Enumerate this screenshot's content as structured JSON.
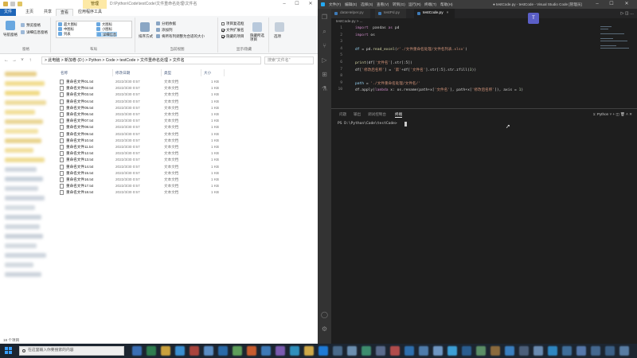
{
  "explorer": {
    "title": {
      "manage_tab": "管理",
      "path": "D:\\Python\\Code\\testCode\\文件重命名处理\\文件名"
    },
    "ribbon_tabs": [
      "文件",
      "主页",
      "共享",
      "查看",
      "应用程序工具"
    ],
    "ribbon": {
      "panes_group": {
        "label": "窗格",
        "nav_pane": "导航窗格",
        "preview_pane": "预览窗格",
        "details_pane": "详细信息窗格"
      },
      "layout_group": {
        "label": "布局",
        "items": [
          "超大图标",
          "大图标",
          "中图标",
          "小图标",
          "列表",
          "详细信息",
          "平铺",
          "内容"
        ],
        "selected": "详细信息"
      },
      "current_view_group": {
        "label": "当前视图",
        "sort_by": "排序方式",
        "group_by": "分组依据",
        "add_columns": "添加列",
        "fit_columns": "将所有列调整为合适的大小"
      },
      "show_hide_group": {
        "label": "显示/隐藏",
        "item_checkboxes": "项目复选框",
        "file_extensions": "文件扩展名",
        "hidden_items": "隐藏的项目",
        "hide_selected": "隐藏所选项目"
      },
      "options_label": "选项"
    },
    "address": "> 此电脑 > 新加卷 (D:) > Python > Code > testCode > 文件重命名处理 > 文件名",
    "search_placeholder": "搜索\"文件名\"",
    "columns": [
      "名称",
      "修改日期",
      "类型",
      "大小"
    ],
    "files": [
      {
        "name": "重命名文件01.txt",
        "date": "2022/3/30 0:57",
        "type": "文本文档",
        "size": "1 KB"
      },
      {
        "name": "重命名文件02.txt",
        "date": "2022/3/30 0:57",
        "type": "文本文档",
        "size": "1 KB"
      },
      {
        "name": "重命名文件03.txt",
        "date": "2022/3/30 0:57",
        "type": "文本文档",
        "size": "1 KB"
      },
      {
        "name": "重命名文件04.txt",
        "date": "2022/3/30 0:57",
        "type": "文本文档",
        "size": "1 KB"
      },
      {
        "name": "重命名文件05.txt",
        "date": "2022/3/30 0:57",
        "type": "文本文档",
        "size": "1 KB"
      },
      {
        "name": "重命名文件06.txt",
        "date": "2022/3/30 0:57",
        "type": "文本文档",
        "size": "1 KB"
      },
      {
        "name": "重命名文件07.txt",
        "date": "2022/3/30 0:57",
        "type": "文本文档",
        "size": "1 KB"
      },
      {
        "name": "重命名文件08.txt",
        "date": "2022/3/30 0:57",
        "type": "文本文档",
        "size": "1 KB"
      },
      {
        "name": "重命名文件09.txt",
        "date": "2022/3/30 0:57",
        "type": "文本文档",
        "size": "1 KB"
      },
      {
        "name": "重命名文件10.txt",
        "date": "2022/3/30 0:57",
        "type": "文本文档",
        "size": "1 KB"
      },
      {
        "name": "重命名文件11.txt",
        "date": "2022/3/30 0:57",
        "type": "文本文档",
        "size": "1 KB"
      },
      {
        "name": "重命名文件12.txt",
        "date": "2022/3/30 0:57",
        "type": "文本文档",
        "size": "1 KB"
      },
      {
        "name": "重命名文件13.txt",
        "date": "2022/3/30 0:57",
        "type": "文本文档",
        "size": "1 KB"
      },
      {
        "name": "重命名文件14.txt",
        "date": "2022/3/30 0:57",
        "type": "文本文档",
        "size": "1 KB"
      },
      {
        "name": "重命名文件15.txt",
        "date": "2022/3/30 0:57",
        "type": "文本文档",
        "size": "1 KB"
      },
      {
        "name": "重命名文件16.txt",
        "date": "2022/3/30 0:57",
        "type": "文本文档",
        "size": "1 KB"
      },
      {
        "name": "重命名文件17.txt",
        "date": "2022/3/30 0:57",
        "type": "文本文档",
        "size": "1 KB"
      },
      {
        "name": "重命名文件18.txt",
        "date": "2022/3/30 0:57",
        "type": "文本文档",
        "size": "1 KB"
      }
    ],
    "status": "18 个项目"
  },
  "vscode": {
    "menu": [
      "文件(F)",
      "编辑(E)",
      "选择(S)",
      "查看(V)",
      "转到(G)",
      "运行(R)",
      "终端(T)",
      "帮助(H)"
    ],
    "window_title": "● testCode.py - testCode - Visual Studio Code [管理员]",
    "tabs": [
      {
        "label": "dataHelper.py",
        "active": false
      },
      {
        "label": "testPd.py",
        "active": false
      },
      {
        "label": "testCode.py",
        "active": true
      }
    ],
    "breadcrumb": "testCode.py > ...",
    "code_lines": [
      {
        "no": "1",
        "html_parts": [
          [
            "kw",
            "import"
          ],
          [
            "",
            "  pandas "
          ],
          [
            "kw",
            "as"
          ],
          [
            "",
            " pd"
          ]
        ]
      },
      {
        "no": "2",
        "html_parts": [
          [
            "kw",
            "import"
          ],
          [
            "",
            "",
            " os"
          ]
        ]
      },
      {
        "no": "3",
        "html_parts": []
      },
      {
        "no": "4",
        "html_parts": [
          [
            "var",
            "df"
          ],
          [
            "",
            " = pd."
          ],
          [
            "fn",
            "read_excel"
          ],
          [
            "",
            "("
          ],
          [
            "str",
            "r'./文件重命名处理/文件名列表.xlsx'"
          ],
          [
            "",
            ")"
          ]
        ]
      },
      {
        "no": "5",
        "html_parts": []
      },
      {
        "no": "6",
        "html_parts": [
          [
            "fn",
            "print"
          ],
          [
            "",
            "(df["
          ],
          [
            "str",
            "'文件名'"
          ],
          [
            "",
            "].str[:5])"
          ]
        ]
      },
      {
        "no": "7",
        "html_parts": [
          [
            "",
            "df["
          ],
          [
            "str",
            "'修改后名称'"
          ],
          [
            "",
            "] = "
          ],
          [
            "str",
            "'第'"
          ],
          [
            "",
            "+df["
          ],
          [
            "str",
            "'文件名'"
          ],
          [
            "",
            "].str[:5].str.zfill("
          ],
          [
            "num",
            "3"
          ],
          [
            "",
            "))"
          ]
        ]
      },
      {
        "no": "8",
        "html_parts": []
      },
      {
        "no": "9",
        "html_parts": [
          [
            "var",
            "path"
          ],
          [
            "",
            " = "
          ],
          [
            "str",
            "'./文件重命名处理/文件名/'"
          ]
        ]
      },
      {
        "no": "10",
        "html_parts": [
          [
            "",
            "df.apply("
          ],
          [
            "kw",
            "lambda"
          ],
          [
            "",
            " x: os.rename(path+x["
          ],
          [
            "str",
            "'文件名'"
          ],
          [
            "",
            "], path+x["
          ],
          [
            "str",
            "'修改后名称'"
          ],
          [
            "",
            "]), axis = "
          ],
          [
            "num",
            "1"
          ],
          [
            "",
            ")"
          ]
        ]
      }
    ],
    "panel_tabs": [
      "问题",
      "输出",
      "调试控制台",
      "终端"
    ],
    "panel_active": "终端",
    "terminal_selector": "1: Python",
    "terminal_prompt": "PS D:\\Python\\Code\\testCode> "
  },
  "taskbar": {
    "search_placeholder": "在这里输入你要搜索的内容"
  },
  "colors": {
    "explorer_file_tab": "#1f66b8",
    "manage_tab": "#fde9a6",
    "vscode_editor_bg": "#1e1e1e",
    "vscode_activity_bar": "#333333",
    "taskbar_bg": "#1c2530"
  },
  "icons": {
    "explorer_qa": "folder-icon",
    "file_row": "text-file-icon",
    "terminal_cursor": "cursor-block"
  }
}
